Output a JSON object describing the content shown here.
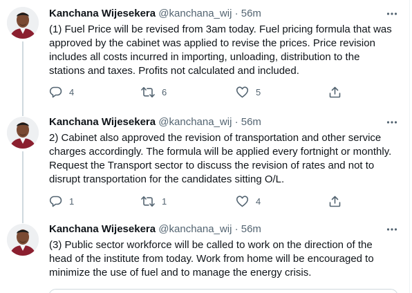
{
  "tweets": [
    {
      "author": "Kanchana Wijesekera",
      "handle": "@kanchana_wij",
      "separator": "·",
      "time": "56m",
      "text": "(1) Fuel Price will be revised from 3am today. Fuel pricing formula that was approved by the cabinet was applied to revise the prices. Price revision includes all costs incurred in importing, unloading, distribution to the stations and taxes. Profits not calculated and included.",
      "replies": "4",
      "retweets": "6",
      "likes": "5"
    },
    {
      "author": "Kanchana Wijesekera",
      "handle": "@kanchana_wij",
      "separator": "·",
      "time": "56m",
      "text": "2) Cabinet also approved the revision of transportation and other service charges accordingly. The formula will be applied every fortnight or monthly. Request the Transport sector to discuss the revision of rates and not to disrupt transportation for the candidates sitting O/L.",
      "replies": "1",
      "retweets": "1",
      "likes": "4"
    },
    {
      "author": "Kanchana Wijesekera",
      "handle": "@kanchana_wij",
      "separator": "·",
      "time": "56m",
      "text": "(3) Public sector workforce will be called to work on the direction of the head of the institute from today. Work from home will be encouraged to minimize the use of fuel and to manage the energy crisis."
    }
  ],
  "icons": {
    "reply": "reply-icon",
    "retweet": "retweet-icon",
    "like": "heart-icon",
    "share": "share-icon",
    "more": "more-icon"
  },
  "colors": {
    "text": "#0f1419",
    "secondary": "#536471",
    "thread_line": "#cfd9de",
    "avatar_shirt": "#8b1f2f"
  }
}
